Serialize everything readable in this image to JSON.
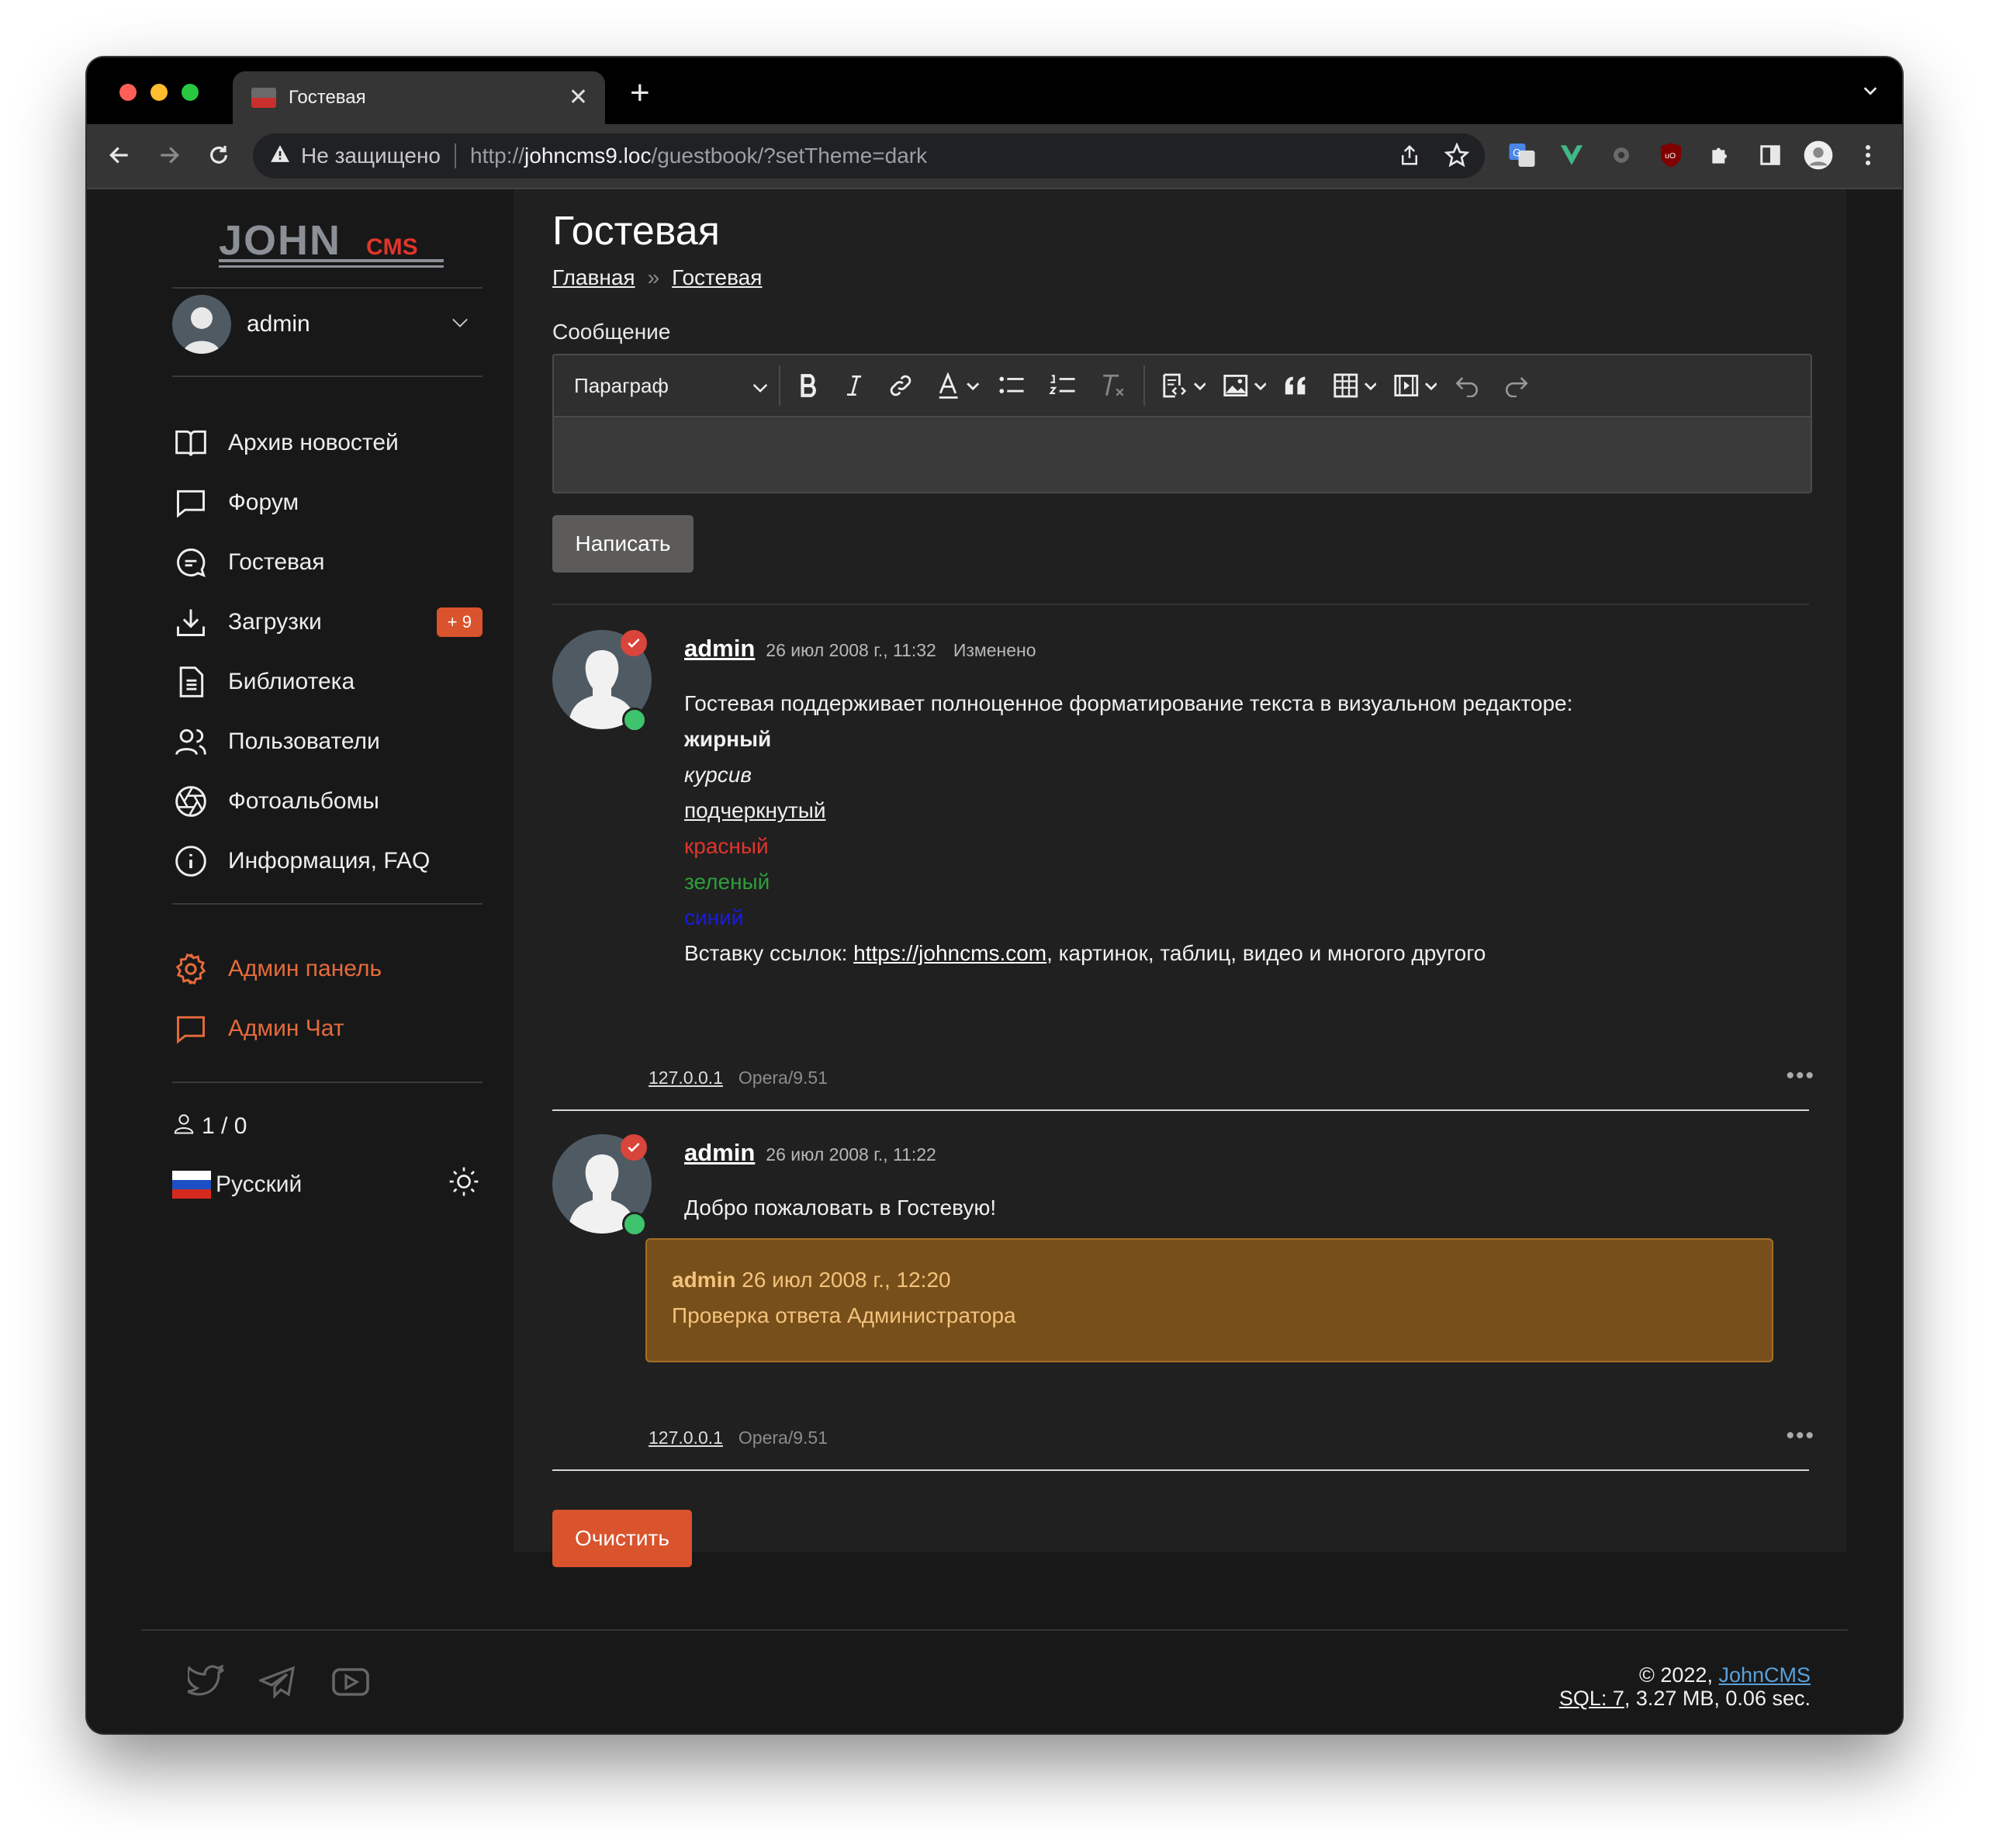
{
  "browser": {
    "tab_title": "Гостевая",
    "security_label": "Не защищено",
    "url_scheme": "http://",
    "url_host": "johncms9.loc",
    "url_path": "/guestbook/?setTheme=dark"
  },
  "logo": {
    "main": "JOHN",
    "accent": "CMS"
  },
  "user": {
    "name": "admin"
  },
  "sidebar": {
    "items": [
      {
        "label": "Архив новостей",
        "icon": "book-open-icon"
      },
      {
        "label": "Форум",
        "icon": "chat-bubble-icon"
      },
      {
        "label": "Гостевая",
        "icon": "guestbook-chat-icon"
      },
      {
        "label": "Загрузки",
        "icon": "download-icon",
        "badge": "+ 9"
      },
      {
        "label": "Библиотека",
        "icon": "document-icon"
      },
      {
        "label": "Пользователи",
        "icon": "users-icon"
      },
      {
        "label": "Фотоальбомы",
        "icon": "aperture-icon"
      },
      {
        "label": "Информация, FAQ",
        "icon": "info-icon"
      }
    ],
    "admin_items": [
      {
        "label": "Админ панель",
        "icon": "gear-icon"
      },
      {
        "label": "Админ Чат",
        "icon": "chat-bubble-icon"
      }
    ],
    "online_stats": "1 / 0",
    "language": "Русский"
  },
  "page": {
    "title": "Гостевая",
    "breadcrumbs": [
      "Главная",
      "Гостевая"
    ],
    "breadcrumb_sep": "»",
    "message_label": "Сообщение",
    "editor_block_format": "Параграф",
    "submit_label": "Написать",
    "clear_label": "Очистить"
  },
  "posts": [
    {
      "author": "admin",
      "date": "26 июл 2008 г., 11:32",
      "edited": "Изменено",
      "lines": {
        "intro": "Гостевая поддерживает полноценное форматирование текста в визуальном редакторе:",
        "bold": "жирный",
        "italic": "курсив",
        "underline": "подчеркнутый",
        "red": "красный",
        "green": "зеленый",
        "blue": "синий",
        "links_prefix": "Вставку ссылок: ",
        "link": "https://johncms.com",
        "links_suffix": ", картинок, таблиц, видео и многого другого"
      },
      "ip": "127.0.0.1",
      "ua": "Opera/9.51"
    },
    {
      "author": "admin",
      "date": "26 июл 2008 г., 11:22",
      "text": "Добро пожаловать в Гостевую!",
      "reply": {
        "author": "admin",
        "date": "26 июл 2008 г., 12:20",
        "text": "Проверка ответа Администратора"
      },
      "ip": "127.0.0.1",
      "ua": "Opera/9.51"
    }
  ],
  "colors": {
    "accent": "#d9532c",
    "red_text": "#e0352b",
    "green_text": "#2e9e3b",
    "blue_text": "#1a1adf",
    "reply_bg": "#774f1b"
  },
  "footer": {
    "copyright_prefix": "© 2022, ",
    "copyright_link": "JohnCMS",
    "sql_label": "SQL: 7",
    "stats_suffix": ", 3.27 MB, 0.06 sec."
  }
}
